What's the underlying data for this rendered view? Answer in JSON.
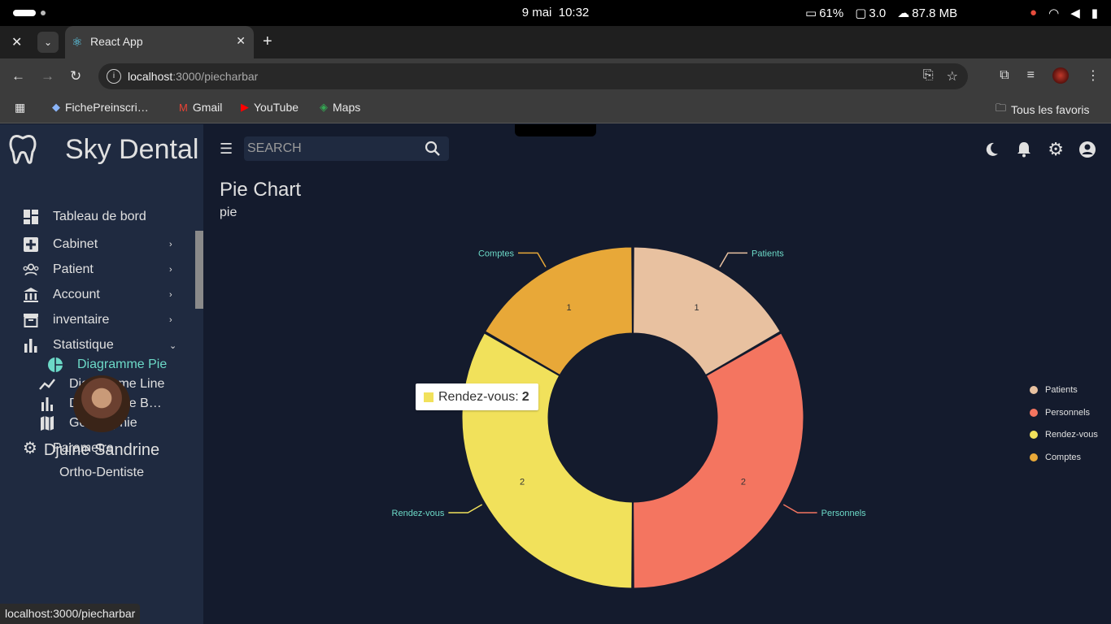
{
  "os": {
    "date": "9 mai",
    "time": "10:32",
    "battery_text": "61%",
    "screen_text": "3.0",
    "memory_text": "87.8 MB"
  },
  "browser": {
    "tab_title": "React App",
    "url_host": "localhost",
    "url_path": ":3000/piecharbar",
    "bookmarks": [
      "FichePreinscri…",
      "Gmail",
      "YouTube",
      "Maps"
    ],
    "all_favorites": "Tous les favoris",
    "status_url": "localhost:3000/piecharbar"
  },
  "app": {
    "brand": "Sky Dental",
    "search_placeholder": "SEARCH",
    "menu": {
      "dashboard": "Tableau de bord",
      "cabinet": "Cabinet",
      "patient": "Patient",
      "account": "Account",
      "inventaire": "inventaire",
      "statistique": "Statistique",
      "pie": "Diagramme Pie",
      "line": "Diagramme Line",
      "bar": "Diagramme B…",
      "geo": "Geographie",
      "parametre": "Parametre"
    },
    "profile": {
      "name": "Djuine Sandrine",
      "role": "Ortho-Dentiste"
    },
    "page_title": "Pie Chart",
    "page_subtitle": "pie"
  },
  "tooltip": {
    "label": "Rendez-vous:",
    "value": "2",
    "color": "#f1e15b"
  },
  "chart_data": {
    "type": "pie",
    "donut": true,
    "categories": [
      "Patients",
      "Personnels",
      "Rendez-vous",
      "Comptes"
    ],
    "values": [
      1,
      2,
      2,
      1
    ],
    "colors": [
      "#e8c1a0",
      "#f47560",
      "#f1e15b",
      "#e8a838"
    ],
    "legend_position": "right"
  }
}
